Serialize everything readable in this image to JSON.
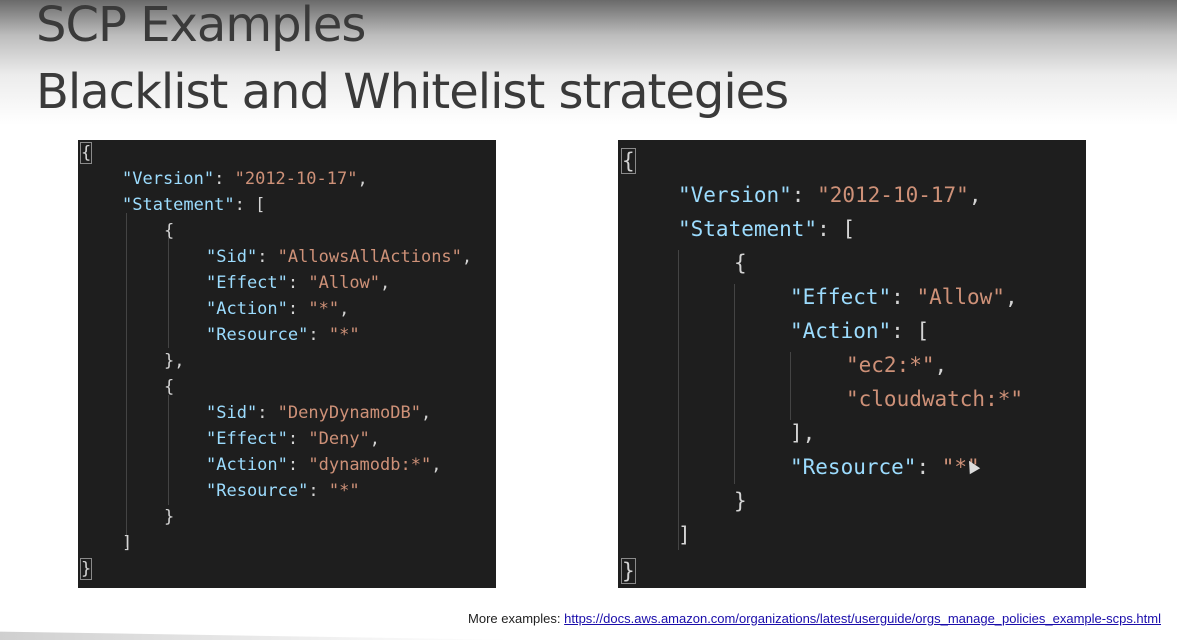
{
  "title": {
    "line1": "SCP Examples",
    "line2": "Blacklist and Whitelist strategies"
  },
  "left_policy": {
    "open_brace": "{",
    "close_brace": "}",
    "version_key": "\"Version\"",
    "version_value": "\"2012-10-17\"",
    "statement_key": "\"Statement\"",
    "statements": [
      {
        "sid_key": "\"Sid\"",
        "sid_value": "\"AllowsAllActions\"",
        "effect_key": "\"Effect\"",
        "effect_value": "\"Allow\"",
        "action_key": "\"Action\"",
        "action_value": "\"*\"",
        "resource_key": "\"Resource\"",
        "resource_value": "\"*\""
      },
      {
        "sid_key": "\"Sid\"",
        "sid_value": "\"DenyDynamoDB\"",
        "effect_key": "\"Effect\"",
        "effect_value": "\"Deny\"",
        "action_key": "\"Action\"",
        "action_value": "\"dynamodb:*\"",
        "resource_key": "\"Resource\"",
        "resource_value": "\"*\""
      }
    ]
  },
  "right_policy": {
    "open_brace": "{",
    "close_brace": "}",
    "version_key": "\"Version\"",
    "version_value": "\"2012-10-17\"",
    "statement_key": "\"Statement\"",
    "effect_key": "\"Effect\"",
    "effect_value": "\"Allow\"",
    "action_key": "\"Action\"",
    "actions": [
      "\"ec2:*\"",
      "\"cloudwatch:*\""
    ],
    "resource_key": "\"Resource\"",
    "resource_value": "\"*\""
  },
  "footer": {
    "label": "More examples:",
    "link": "https://docs.aws.amazon.com/organizations/latest/userguide/orgs_manage_policies_example-scps.html"
  }
}
